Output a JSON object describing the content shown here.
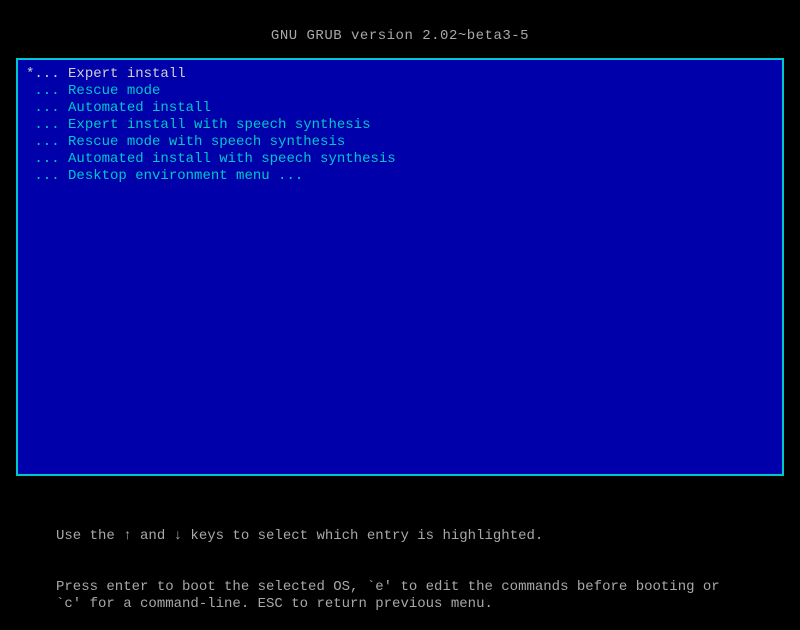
{
  "header": {
    "title": "GNU GRUB  version 2.02~beta3-5"
  },
  "menu": {
    "items": [
      {
        "prefix": "*... ",
        "label": "Expert install",
        "selected": true
      },
      {
        "prefix": " ... ",
        "label": "Rescue mode",
        "selected": false
      },
      {
        "prefix": " ... ",
        "label": "Automated install",
        "selected": false
      },
      {
        "prefix": " ... ",
        "label": "Expert install with speech synthesis",
        "selected": false
      },
      {
        "prefix": " ... ",
        "label": "Rescue mode with speech synthesis",
        "selected": false
      },
      {
        "prefix": " ... ",
        "label": "Automated install with speech synthesis",
        "selected": false
      },
      {
        "prefix": " ... ",
        "label": "Desktop environment menu ...",
        "selected": false
      }
    ]
  },
  "help": {
    "line1": "Use the ↑ and ↓ keys to select which entry is highlighted.",
    "line2": "Press enter to boot the selected OS, `e' to edit the commands before booting or `c' for a command-line. ESC to return previous menu."
  }
}
